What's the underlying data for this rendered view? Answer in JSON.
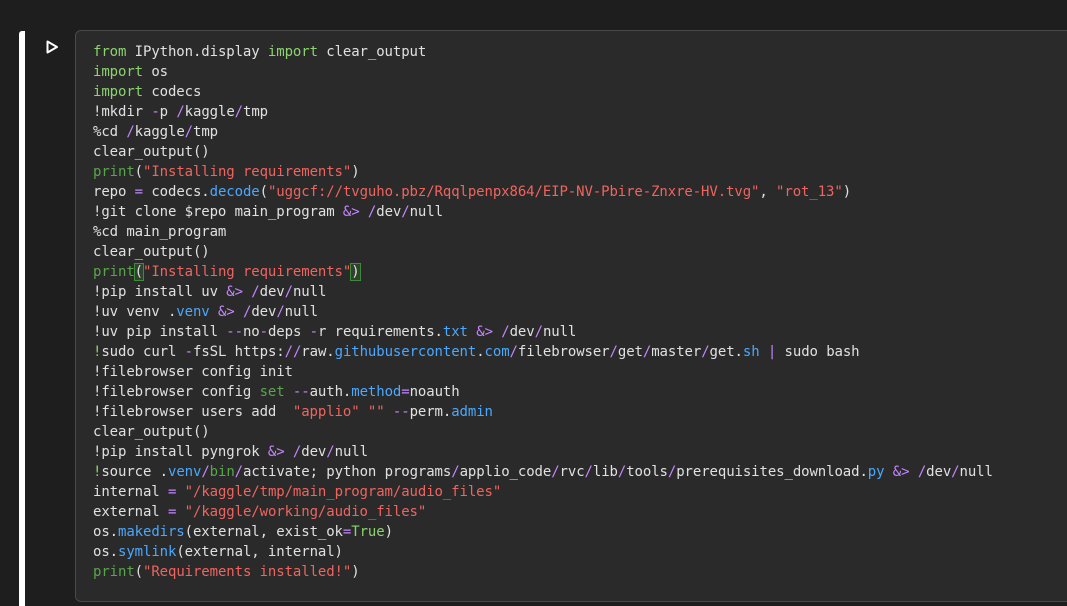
{
  "colors": {
    "background": "#1e1e1e",
    "editor_background": "#2a2a2a",
    "keyword": "#8bd36f",
    "function": "#57a64a",
    "string": "#f0645f",
    "attribute": "#4aa8ff",
    "operator": "#c586ff",
    "text": "#e0e0e0"
  },
  "run_button": {
    "icon": "play-icon"
  },
  "code_lines": [
    [
      [
        "kw",
        "from"
      ],
      [
        "plain",
        " IPython.display "
      ],
      [
        "kw",
        "import"
      ],
      [
        "plain",
        " clear_output"
      ]
    ],
    [
      [
        "kw",
        "import"
      ],
      [
        "plain",
        " os"
      ]
    ],
    [
      [
        "kw",
        "import"
      ],
      [
        "plain",
        " codecs"
      ]
    ],
    [
      [
        "plain",
        "!mkdir "
      ],
      [
        "op",
        "-"
      ],
      [
        "plain",
        "p "
      ],
      [
        "op",
        "/"
      ],
      [
        "plain",
        "kaggle"
      ],
      [
        "op",
        "/"
      ],
      [
        "plain",
        "tmp"
      ]
    ],
    [
      [
        "plain",
        "%cd "
      ],
      [
        "op",
        "/"
      ],
      [
        "plain",
        "kaggle"
      ],
      [
        "op",
        "/"
      ],
      [
        "plain",
        "tmp"
      ]
    ],
    [
      [
        "plain",
        "clear_output()"
      ]
    ],
    [
      [
        "fn",
        "print"
      ],
      [
        "plain",
        "("
      ],
      [
        "str",
        "\"Installing requirements\""
      ],
      [
        "plain",
        ")"
      ]
    ],
    [
      [
        "plain",
        "repo "
      ],
      [
        "op",
        "="
      ],
      [
        "plain",
        " codecs."
      ],
      [
        "attr",
        "decode"
      ],
      [
        "plain",
        "("
      ],
      [
        "str",
        "\"uggcf://tvguho.pbz/Rqqlpenpx864/EIP-NV-Pbire-Znxre-HV.tvg\""
      ],
      [
        "plain",
        ", "
      ],
      [
        "str",
        "\"rot_13\""
      ],
      [
        "plain",
        ")"
      ]
    ],
    [
      [
        "plain",
        "!git clone $repo main_program "
      ],
      [
        "op",
        "&>"
      ],
      [
        "plain",
        " "
      ],
      [
        "op",
        "/"
      ],
      [
        "plain",
        "dev"
      ],
      [
        "op",
        "/"
      ],
      [
        "plain",
        "null"
      ]
    ],
    [
      [
        "plain",
        "%cd main_program"
      ]
    ],
    [
      [
        "plain",
        "clear_output()"
      ]
    ],
    [
      [
        "fn",
        "print"
      ],
      [
        "cursor",
        "("
      ],
      [
        "str",
        "\"Installing requirements\""
      ],
      [
        "cursor",
        ")"
      ]
    ],
    [
      [
        "plain",
        "!pip install uv "
      ],
      [
        "op",
        "&>"
      ],
      [
        "plain",
        " "
      ],
      [
        "op",
        "/"
      ],
      [
        "plain",
        "dev"
      ],
      [
        "op",
        "/"
      ],
      [
        "plain",
        "null"
      ]
    ],
    [
      [
        "plain",
        "!uv venv ."
      ],
      [
        "attr",
        "venv"
      ],
      [
        "plain",
        " "
      ],
      [
        "op",
        "&>"
      ],
      [
        "plain",
        " "
      ],
      [
        "op",
        "/"
      ],
      [
        "plain",
        "dev"
      ],
      [
        "op",
        "/"
      ],
      [
        "plain",
        "null"
      ]
    ],
    [
      [
        "plain",
        "!uv pip install "
      ],
      [
        "op",
        "--"
      ],
      [
        "plain",
        "no"
      ],
      [
        "op",
        "-"
      ],
      [
        "plain",
        "deps "
      ],
      [
        "op",
        "-"
      ],
      [
        "plain",
        "r requirements."
      ],
      [
        "attr",
        "txt"
      ],
      [
        "plain",
        " "
      ],
      [
        "op",
        "&>"
      ],
      [
        "plain",
        " "
      ],
      [
        "op",
        "/"
      ],
      [
        "plain",
        "dev"
      ],
      [
        "op",
        "/"
      ],
      [
        "plain",
        "null"
      ]
    ],
    [
      [
        "kw",
        "!"
      ],
      [
        "plain",
        "sudo curl "
      ],
      [
        "op",
        "-"
      ],
      [
        "plain",
        "fsSL https:"
      ],
      [
        "op",
        "//"
      ],
      [
        "plain",
        "raw."
      ],
      [
        "attr",
        "githubusercontent"
      ],
      [
        "plain",
        "."
      ],
      [
        "attr",
        "com"
      ],
      [
        "op",
        "/"
      ],
      [
        "plain",
        "filebrowser"
      ],
      [
        "op",
        "/"
      ],
      [
        "plain",
        "get"
      ],
      [
        "op",
        "/"
      ],
      [
        "plain",
        "master"
      ],
      [
        "op",
        "/"
      ],
      [
        "plain",
        "get."
      ],
      [
        "attr",
        "sh"
      ],
      [
        "plain",
        " "
      ],
      [
        "op",
        "|"
      ],
      [
        "plain",
        " sudo bash"
      ]
    ],
    [
      [
        "plain",
        "!filebrowser config init"
      ]
    ],
    [
      [
        "plain",
        "!filebrowser config "
      ],
      [
        "fn",
        "set"
      ],
      [
        "plain",
        " "
      ],
      [
        "op",
        "--"
      ],
      [
        "plain",
        "auth."
      ],
      [
        "attr",
        "method"
      ],
      [
        "op",
        "="
      ],
      [
        "plain",
        "noauth"
      ]
    ],
    [
      [
        "plain",
        "!filebrowser users add  "
      ],
      [
        "str",
        "\"applio\""
      ],
      [
        "plain",
        " "
      ],
      [
        "str",
        "\"\""
      ],
      [
        "plain",
        " "
      ],
      [
        "op",
        "--"
      ],
      [
        "plain",
        "perm."
      ],
      [
        "attr",
        "admin"
      ]
    ],
    [
      [
        "plain",
        "clear_output()"
      ]
    ],
    [
      [
        "plain",
        "!pip install pyngrok "
      ],
      [
        "op",
        "&>"
      ],
      [
        "plain",
        " "
      ],
      [
        "op",
        "/"
      ],
      [
        "plain",
        "dev"
      ],
      [
        "op",
        "/"
      ],
      [
        "plain",
        "null"
      ]
    ],
    [
      [
        "kw",
        "!"
      ],
      [
        "plain",
        "source ."
      ],
      [
        "attr",
        "venv"
      ],
      [
        "op",
        "/"
      ],
      [
        "fn",
        "bin"
      ],
      [
        "op",
        "/"
      ],
      [
        "plain",
        "activate; python programs"
      ],
      [
        "op",
        "/"
      ],
      [
        "plain",
        "applio_code"
      ],
      [
        "op",
        "/"
      ],
      [
        "plain",
        "rvc"
      ],
      [
        "op",
        "/"
      ],
      [
        "plain",
        "lib"
      ],
      [
        "op",
        "/"
      ],
      [
        "plain",
        "tools"
      ],
      [
        "op",
        "/"
      ],
      [
        "plain",
        "prerequisites_download."
      ],
      [
        "attr",
        "py"
      ],
      [
        "plain",
        " "
      ],
      [
        "op",
        "&>"
      ],
      [
        "plain",
        " "
      ],
      [
        "op",
        "/"
      ],
      [
        "plain",
        "dev"
      ],
      [
        "op",
        "/"
      ],
      [
        "plain",
        "null"
      ]
    ],
    [
      [
        "plain",
        "internal "
      ],
      [
        "op",
        "="
      ],
      [
        "plain",
        " "
      ],
      [
        "str",
        "\"/kaggle/tmp/main_program/audio_files\""
      ]
    ],
    [
      [
        "plain",
        "external "
      ],
      [
        "op",
        "="
      ],
      [
        "plain",
        " "
      ],
      [
        "str",
        "\"/kaggle/working/audio_files\""
      ]
    ],
    [
      [
        "plain",
        "os."
      ],
      [
        "attr",
        "makedirs"
      ],
      [
        "plain",
        "(external, exist_ok"
      ],
      [
        "op",
        "="
      ],
      [
        "kw",
        "True"
      ],
      [
        "plain",
        ")"
      ]
    ],
    [
      [
        "plain",
        "os."
      ],
      [
        "attr",
        "symlink"
      ],
      [
        "plain",
        "(external, internal)"
      ]
    ],
    [
      [
        "fn",
        "print"
      ],
      [
        "plain",
        "("
      ],
      [
        "str",
        "\"Requirements installed!\""
      ],
      [
        "plain",
        ")"
      ]
    ]
  ]
}
